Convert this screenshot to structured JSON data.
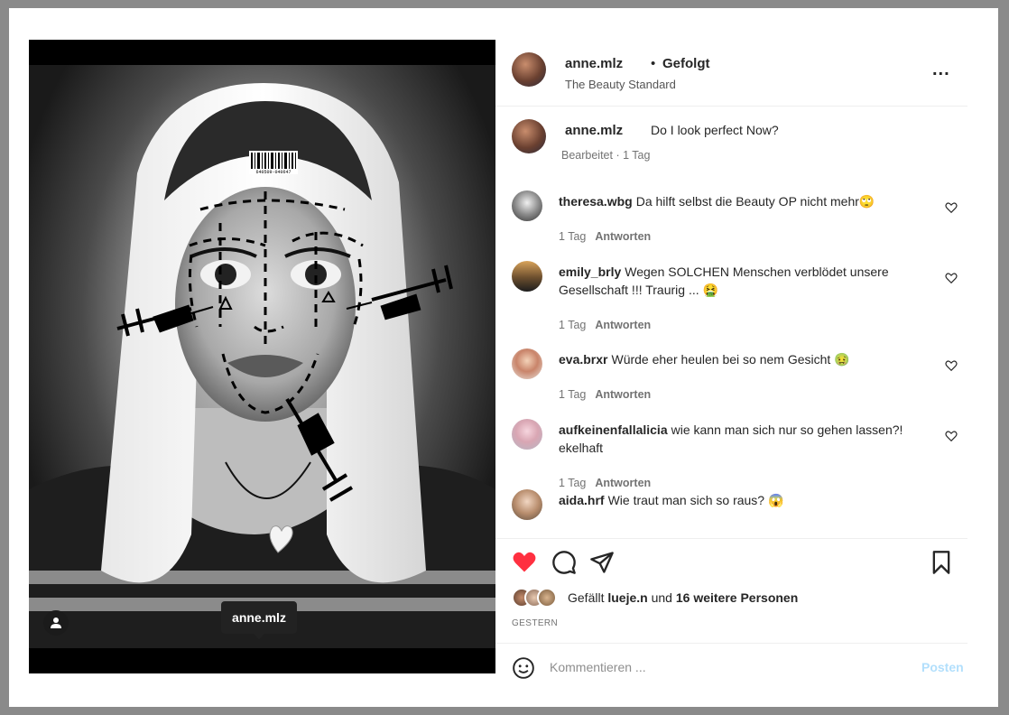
{
  "photo": {
    "barcode_text": "640509-040647",
    "tag_tooltip": "anne.mlz",
    "user_tag_icon": "person-icon"
  },
  "header": {
    "username": "anne.mlz",
    "dot": "•",
    "follow_label": "Gefolgt",
    "subtitle": "The Beauty Standard",
    "more_icon": "more-horizontal-icon",
    "more_label": "..."
  },
  "caption": {
    "username": "anne.mlz",
    "text": "Do I look perfect Now?",
    "meta": "Bearbeitet · 1 Tag"
  },
  "comments": [
    {
      "user": "theresa.wbg",
      "text": "Da hilft selbst die Beauty OP nicht mehr🙄",
      "time": "1 Tag",
      "reply": "Antworten"
    },
    {
      "user": "emily_brly",
      "text": "Wegen SOLCHEN Menschen verblödet unsere Gesellschaft !!! Traurig ... 🤮",
      "time": "1 Tag",
      "reply": "Antworten"
    },
    {
      "user": "eva.brxr",
      "text": "Würde eher heulen bei so nem Gesicht 🤢",
      "time": "1 Tag",
      "reply": "Antworten"
    },
    {
      "user": "aufkeinenfallalicia",
      "text": "wie kann man sich nur so gehen lassen?! ekelhaft",
      "time": "1 Tag",
      "reply": "Antworten"
    },
    {
      "user": "aida.hrf",
      "text": "Wie traut man sich so raus? 😱"
    }
  ],
  "actions": {
    "like_icon": "heart-filled-icon",
    "comment_icon": "comment-bubble-icon",
    "share_icon": "send-paper-plane-icon",
    "save_icon": "bookmark-icon",
    "liked_color": "#ff3040"
  },
  "likes": {
    "prefix": "Gefällt ",
    "user": "lueje.n",
    "middle": " und ",
    "others": "16 weitere Personen"
  },
  "posted_label": "GESTERN",
  "comment_box": {
    "emoji_icon": "smiley-face-icon",
    "placeholder": "Kommentieren ...",
    "post_label": "Posten",
    "post_color": "#b2dffc"
  }
}
